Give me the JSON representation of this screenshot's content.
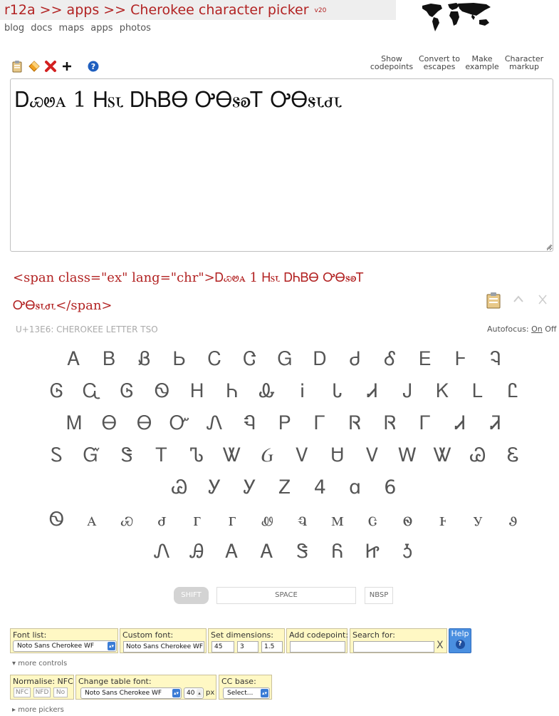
{
  "header": {
    "title": "r12a >> apps >> Cherokee character picker",
    "version": "v20",
    "nav": [
      "blog",
      "docs",
      "maps",
      "apps",
      "photos"
    ]
  },
  "toolbar": {
    "buttons": [
      {
        "l1": "Show",
        "l2": "codepoints"
      },
      {
        "l1": "Convert to",
        "l2": "escapes"
      },
      {
        "l1": "Make",
        "l2": "example"
      },
      {
        "l1": "Character",
        "l2": "markup"
      }
    ]
  },
  "output_text": "Ꭰꮿꮼꭺ 1 Ꮋꮪꮣ ᎠᏂᏴᎾ ᎤᎾꮥꭷᎢ ᎤᎾꮥꮣꮷꮣ",
  "markup_text": "<span class=\"ex\" lang=\"chr\">Ꭰꮿꮼꭺ 1 Ꮋꮪꮣ ᎠᏂᏴᎾ ᎤᎾꮥꭷᎢ ᎤᎾꮥꮣꮷꮣ</span>",
  "char_info": "U+13E6: CHEROKEE LETTER TSO",
  "autofocus": {
    "label": "Autofocus:",
    "on": "On",
    "off": "Off"
  },
  "char_rows": [
    [
      "Ꭺ",
      "Ᏼ",
      "Ᏸ",
      "Ꮟ",
      "Ꮯ",
      "Ꮳ",
      "Ꮐ",
      "Ꭰ",
      "Ꮷ",
      "Ꮄ",
      "Ꭼ",
      "Ꮀ",
      "Ꮈ"
    ],
    [
      "Ꮆ",
      "Ꮹ",
      "Ꮆ",
      "Ꮻ",
      "Ꮋ",
      "Ꮒ",
      "Ꮂ",
      "Ꭵ",
      "Ꮣ",
      "Ꮧ",
      "Ꭻ",
      "Ꮶ",
      "Ꮮ",
      "Ꮭ"
    ],
    [
      "Ꮇ",
      "Ꮎ",
      "Ꮎ",
      "Ꮕ",
      "Ꮑ",
      "Ꮔ",
      "Ꮲ",
      "Ꮁ",
      "Ꮢ",
      "Ꮢ",
      "Ꮁ",
      "Ꮧ",
      "Ꮨ"
    ],
    [
      "Ꮪ",
      "Ᏻ",
      "Ꮥ",
      "Ꭲ",
      "Ꮦ",
      "Ꮤ",
      "Ᏽ",
      "Ꮩ",
      "Ꮜ",
      "Ꮩ",
      "Ꮃ",
      "Ꮤ",
      "Ꮚ",
      "Ꮛ"
    ],
    [
      "Ꮚ",
      "Ꭹ",
      "Ꭹ",
      "Ꮓ",
      "4",
      "ɑ",
      "6"
    ],
    [
      "Ꮻ",
      "ꭺ",
      "ꮿ",
      "ꮷ",
      "ꮁ",
      "ꮁ",
      "ꮺ",
      "ꮔ",
      "ꮇ",
      "ꮳ",
      "ꮻ",
      "ꮀ",
      "ꭹ",
      "ꮽ"
    ],
    [
      "Ꮑ",
      "Ꭿ",
      "Ꭺ",
      "Ꭺ",
      "Ꮥ",
      "Ᏺ",
      "Ꮵ",
      "Ꮌ"
    ]
  ],
  "space_controls": {
    "shift": "SHIFT",
    "space": "SPACE",
    "nbsp": "NBSP"
  },
  "controls": {
    "font_list": {
      "label": "Font list:",
      "value": "Noto Sans Cherokee WF"
    },
    "custom_font": {
      "label": "Custom font:",
      "value": "Noto Sans Cherokee WF"
    },
    "dimensions": {
      "label": "Set dimensions:",
      "v1": "45",
      "v2": "3",
      "v3": "1.5"
    },
    "add_codepoint": {
      "label": "Add codepoint:",
      "value": ""
    },
    "search": {
      "label": "Search for:",
      "value": "",
      "clear": "X"
    },
    "help": {
      "label": "Help",
      "icon": "?"
    },
    "more_controls": "more controls",
    "normalise": {
      "label": "Normalise: NFC",
      "nfc": "NFC",
      "nfd": "NFD",
      "no": "No"
    },
    "table_font": {
      "label": "Change table font:",
      "value": "Noto Sans Cherokee WF",
      "size": "40",
      "unit": "px"
    },
    "cc_base": {
      "label": "CC base:",
      "value": "Select..."
    },
    "more_pickers": "more pickers"
  },
  "colors": {
    "title_red": "#b22222",
    "panel_bg": "#fff8c4",
    "help_blue": "#4a8fe0"
  }
}
